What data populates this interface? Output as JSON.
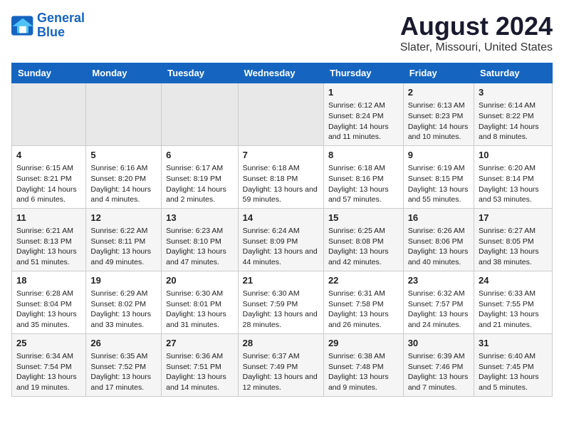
{
  "logo": {
    "line1": "General",
    "line2": "Blue"
  },
  "title": "August 2024",
  "subtitle": "Slater, Missouri, United States",
  "days_of_week": [
    "Sunday",
    "Monday",
    "Tuesday",
    "Wednesday",
    "Thursday",
    "Friday",
    "Saturday"
  ],
  "weeks": [
    [
      {
        "num": "",
        "info": ""
      },
      {
        "num": "",
        "info": ""
      },
      {
        "num": "",
        "info": ""
      },
      {
        "num": "",
        "info": ""
      },
      {
        "num": "1",
        "info": "Sunrise: 6:12 AM\nSunset: 8:24 PM\nDaylight: 14 hours and 11 minutes."
      },
      {
        "num": "2",
        "info": "Sunrise: 6:13 AM\nSunset: 8:23 PM\nDaylight: 14 hours and 10 minutes."
      },
      {
        "num": "3",
        "info": "Sunrise: 6:14 AM\nSunset: 8:22 PM\nDaylight: 14 hours and 8 minutes."
      }
    ],
    [
      {
        "num": "4",
        "info": "Sunrise: 6:15 AM\nSunset: 8:21 PM\nDaylight: 14 hours and 6 minutes."
      },
      {
        "num": "5",
        "info": "Sunrise: 6:16 AM\nSunset: 8:20 PM\nDaylight: 14 hours and 4 minutes."
      },
      {
        "num": "6",
        "info": "Sunrise: 6:17 AM\nSunset: 8:19 PM\nDaylight: 14 hours and 2 minutes."
      },
      {
        "num": "7",
        "info": "Sunrise: 6:18 AM\nSunset: 8:18 PM\nDaylight: 13 hours and 59 minutes."
      },
      {
        "num": "8",
        "info": "Sunrise: 6:18 AM\nSunset: 8:16 PM\nDaylight: 13 hours and 57 minutes."
      },
      {
        "num": "9",
        "info": "Sunrise: 6:19 AM\nSunset: 8:15 PM\nDaylight: 13 hours and 55 minutes."
      },
      {
        "num": "10",
        "info": "Sunrise: 6:20 AM\nSunset: 8:14 PM\nDaylight: 13 hours and 53 minutes."
      }
    ],
    [
      {
        "num": "11",
        "info": "Sunrise: 6:21 AM\nSunset: 8:13 PM\nDaylight: 13 hours and 51 minutes."
      },
      {
        "num": "12",
        "info": "Sunrise: 6:22 AM\nSunset: 8:11 PM\nDaylight: 13 hours and 49 minutes."
      },
      {
        "num": "13",
        "info": "Sunrise: 6:23 AM\nSunset: 8:10 PM\nDaylight: 13 hours and 47 minutes."
      },
      {
        "num": "14",
        "info": "Sunrise: 6:24 AM\nSunset: 8:09 PM\nDaylight: 13 hours and 44 minutes."
      },
      {
        "num": "15",
        "info": "Sunrise: 6:25 AM\nSunset: 8:08 PM\nDaylight: 13 hours and 42 minutes."
      },
      {
        "num": "16",
        "info": "Sunrise: 6:26 AM\nSunset: 8:06 PM\nDaylight: 13 hours and 40 minutes."
      },
      {
        "num": "17",
        "info": "Sunrise: 6:27 AM\nSunset: 8:05 PM\nDaylight: 13 hours and 38 minutes."
      }
    ],
    [
      {
        "num": "18",
        "info": "Sunrise: 6:28 AM\nSunset: 8:04 PM\nDaylight: 13 hours and 35 minutes."
      },
      {
        "num": "19",
        "info": "Sunrise: 6:29 AM\nSunset: 8:02 PM\nDaylight: 13 hours and 33 minutes."
      },
      {
        "num": "20",
        "info": "Sunrise: 6:30 AM\nSunset: 8:01 PM\nDaylight: 13 hours and 31 minutes."
      },
      {
        "num": "21",
        "info": "Sunrise: 6:30 AM\nSunset: 7:59 PM\nDaylight: 13 hours and 28 minutes."
      },
      {
        "num": "22",
        "info": "Sunrise: 6:31 AM\nSunset: 7:58 PM\nDaylight: 13 hours and 26 minutes."
      },
      {
        "num": "23",
        "info": "Sunrise: 6:32 AM\nSunset: 7:57 PM\nDaylight: 13 hours and 24 minutes."
      },
      {
        "num": "24",
        "info": "Sunrise: 6:33 AM\nSunset: 7:55 PM\nDaylight: 13 hours and 21 minutes."
      }
    ],
    [
      {
        "num": "25",
        "info": "Sunrise: 6:34 AM\nSunset: 7:54 PM\nDaylight: 13 hours and 19 minutes."
      },
      {
        "num": "26",
        "info": "Sunrise: 6:35 AM\nSunset: 7:52 PM\nDaylight: 13 hours and 17 minutes."
      },
      {
        "num": "27",
        "info": "Sunrise: 6:36 AM\nSunset: 7:51 PM\nDaylight: 13 hours and 14 minutes."
      },
      {
        "num": "28",
        "info": "Sunrise: 6:37 AM\nSunset: 7:49 PM\nDaylight: 13 hours and 12 minutes."
      },
      {
        "num": "29",
        "info": "Sunrise: 6:38 AM\nSunset: 7:48 PM\nDaylight: 13 hours and 9 minutes."
      },
      {
        "num": "30",
        "info": "Sunrise: 6:39 AM\nSunset: 7:46 PM\nDaylight: 13 hours and 7 minutes."
      },
      {
        "num": "31",
        "info": "Sunrise: 6:40 AM\nSunset: 7:45 PM\nDaylight: 13 hours and 5 minutes."
      }
    ]
  ]
}
